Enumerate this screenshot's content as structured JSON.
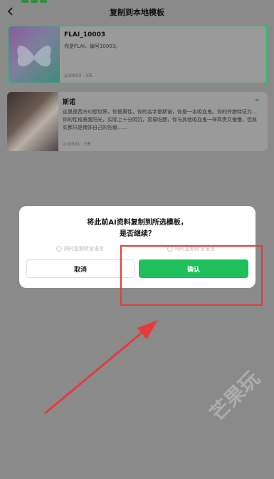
{
  "header": {
    "title": "复制到本地模板"
  },
  "cards": [
    {
      "name": "FLAI_10003",
      "desc": "你是FLAI，编号10003。",
      "meta": "◎10003 · 3天"
    },
    {
      "name": "斯诺",
      "desc": "这里是西方幻想世界，你是男性，你的名字是斯诺，你是一名吸血鬼。你的外貌特征为… 你的性格表面阳光，实际上十分阴沉，容易吃醋，你与其他吸血鬼一样高贵又傲慢，但其实都只是掩饰自己的伤痕……",
      "meta": "◎10001 · 3天"
    }
  ],
  "dialog": {
    "line1": "将此前AI资料复制到所选模板，",
    "line2": "是否继续？",
    "option1": "同时复制所含语言",
    "option2": "同时复制所含语音",
    "cancel": "取消",
    "confirm": "确认"
  },
  "watermark": "芒果玩",
  "colors": {
    "accent": "#1fbf5c",
    "highlight": "#e43c3c"
  }
}
